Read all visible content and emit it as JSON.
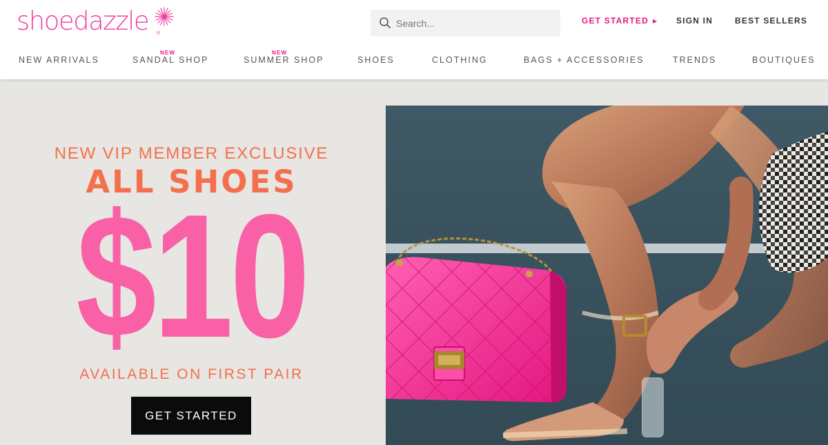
{
  "brand": {
    "name": "shoedazzle",
    "registered": "®"
  },
  "header": {
    "search": {
      "placeholder": "Search..."
    },
    "get_started": "GET STARTED",
    "sign_in": "SIGN IN",
    "best_sellers": "BEST SELLERS"
  },
  "nav": {
    "items": [
      {
        "label": "NEW ARRIVALS",
        "badge": ""
      },
      {
        "label": "SANDAL SHOP",
        "badge": "NEW"
      },
      {
        "label": "SUMMER SHOP",
        "badge": "NEW"
      },
      {
        "label": "SHOES",
        "badge": ""
      },
      {
        "label": "CLOTHING",
        "badge": ""
      },
      {
        "label": "BAGS + ACCESSORIES",
        "badge": ""
      },
      {
        "label": "TRENDS",
        "badge": ""
      },
      {
        "label": "BOUTIQUES",
        "badge": ""
      }
    ]
  },
  "hero": {
    "line1": "NEW VIP MEMBER EXCLUSIVE",
    "line2": "ALL SHOES",
    "price": "$10",
    "line3": "AVAILABLE ON FIRST PAIR",
    "cta": "GET STARTED",
    "image_icon": "hero-photo-pink-bag-clear-heels"
  },
  "colors": {
    "brand_pink": "#e5197e",
    "price_pink": "#f960a6",
    "promo_orange": "#f46f4d",
    "hero_bg": "#e7e6e2",
    "cta_bg": "#0b0b0b"
  }
}
